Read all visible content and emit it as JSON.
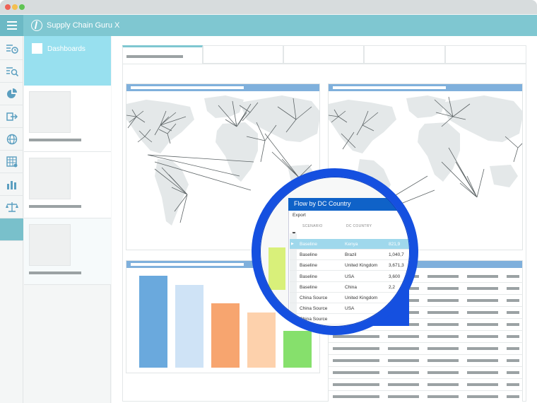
{
  "app": {
    "title": "Supply Chain Guru X"
  },
  "sidebar": {
    "dashboards_label": "Dashboards"
  },
  "rail_icons": [
    "scenario-icon",
    "search-list-icon",
    "pie-chart-icon",
    "export-icon",
    "globe-icon",
    "table-icon",
    "bar-chart-icon",
    "scales-icon"
  ],
  "colors": {
    "appbar": "#7fc7d1",
    "panel_header": "#7fb0dc",
    "lens": "#1550e0",
    "selected_row": "#9fd8ec"
  },
  "bar_chart": {
    "values": [
      100,
      90,
      70,
      60,
      40
    ],
    "colors": [
      "#6aa9dd",
      "#cfe3f6",
      "#f7a56f",
      "#fdd1ac",
      "#86e06c"
    ]
  },
  "zoom_panel": {
    "title": "Flow by DC Country",
    "export_label": "Export",
    "columns": [
      "SCENARIO",
      "DC COUNTRY"
    ],
    "rows": [
      {
        "scenario": "Baseline",
        "country": "Kenya",
        "value": "821,9",
        "selected": true
      },
      {
        "scenario": "Baseline",
        "country": "Brazil",
        "value": "1,040,7"
      },
      {
        "scenario": "Baseline",
        "country": "United Kingdom",
        "value": "3,671,3"
      },
      {
        "scenario": "Baseline",
        "country": "USA",
        "value": "3,600"
      },
      {
        "scenario": "Baseline",
        "country": "China",
        "value": "2,2"
      },
      {
        "scenario": "China Source",
        "country": "United Kingdom",
        "value": ""
      },
      {
        "scenario": "China Source",
        "country": "USA",
        "value": ""
      },
      {
        "scenario": "China Source",
        "country": "",
        "value": ""
      }
    ]
  }
}
